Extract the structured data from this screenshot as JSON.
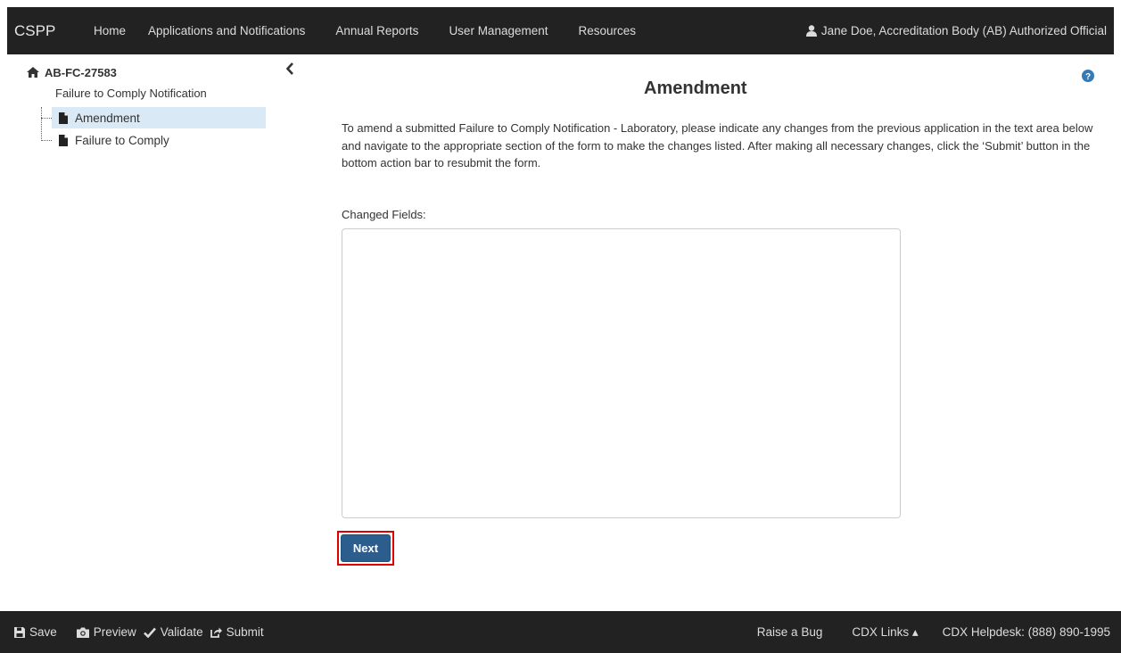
{
  "topbar": {
    "brand": "CSPP",
    "nav": [
      "Home",
      "Applications and Notifications",
      "Annual Reports",
      "User Management",
      "Resources"
    ],
    "user": "Jane Doe, Accreditation Body (AB) Authorized Official"
  },
  "sidebar": {
    "root_id": "AB-FC-27583",
    "root_subtitle": "Failure to Comply Notification",
    "items": [
      {
        "label": "Amendment",
        "selected": true
      },
      {
        "label": "Failure to Comply",
        "selected": false
      }
    ]
  },
  "main": {
    "title": "Amendment",
    "description": "To amend a submitted Failure to Comply Notification - Laboratory, please indicate any changes from the previous application in the text area below and navigate to the appropriate section of the form to make the changes listed. After making all necessary changes, click the ‘Submit’ button in the bottom action bar to resubmit the form.",
    "changed_fields_label": "Changed Fields:",
    "changed_fields_value": "",
    "next_label": "Next"
  },
  "bottombar": {
    "save": "Save",
    "preview": "Preview",
    "validate": "Validate",
    "submit": "Submit",
    "raise_bug": "Raise a Bug",
    "cdx_links": "CDX Links ▴",
    "helpdesk": "CDX Helpdesk: (888) 890-1995"
  },
  "colors": {
    "navbar": "#222222",
    "selected_row": "#d9eaf6",
    "primary_button": "#2c5d8f",
    "highlight": "#e00000",
    "help_icon": "#337ab7"
  }
}
